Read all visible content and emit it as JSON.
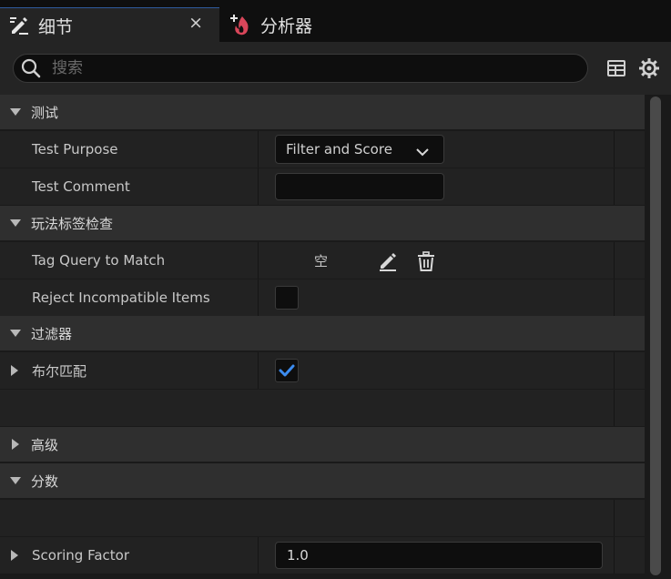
{
  "tabs": [
    {
      "label": "细节",
      "icon": "pencil-list-icon",
      "active": true
    },
    {
      "label": "分析器",
      "icon": "flame-plus-icon",
      "active": false
    }
  ],
  "close_label": "×",
  "search": {
    "placeholder": "搜索",
    "value": ""
  },
  "toolbar_icons": [
    "table-view-icon",
    "settings-gear-icon"
  ],
  "categories": {
    "test": "测试",
    "gameplay_tags": "玩法标签检查",
    "filter": "过滤器",
    "advanced": "高级",
    "score": "分数"
  },
  "properties": {
    "test_purpose": {
      "label": "Test Purpose",
      "value": "Filter and Score"
    },
    "test_comment": {
      "label": "Test Comment",
      "value": ""
    },
    "tag_query": {
      "label": "Tag Query to Match",
      "value": "空"
    },
    "reject_incompatible": {
      "label": "Reject Incompatible Items",
      "checked": false
    },
    "bool_match": {
      "label": "布尔匹配",
      "checked": true
    },
    "scoring_factor": {
      "label": "Scoring Factor",
      "value": "1.0"
    }
  },
  "colors": {
    "accent": "#2a7bde",
    "checkmark": "#3c8cf0",
    "flame": "#d9465a",
    "background": "#1a1a1a",
    "category_row": "#2f2f2f",
    "property_row": "#222222"
  }
}
